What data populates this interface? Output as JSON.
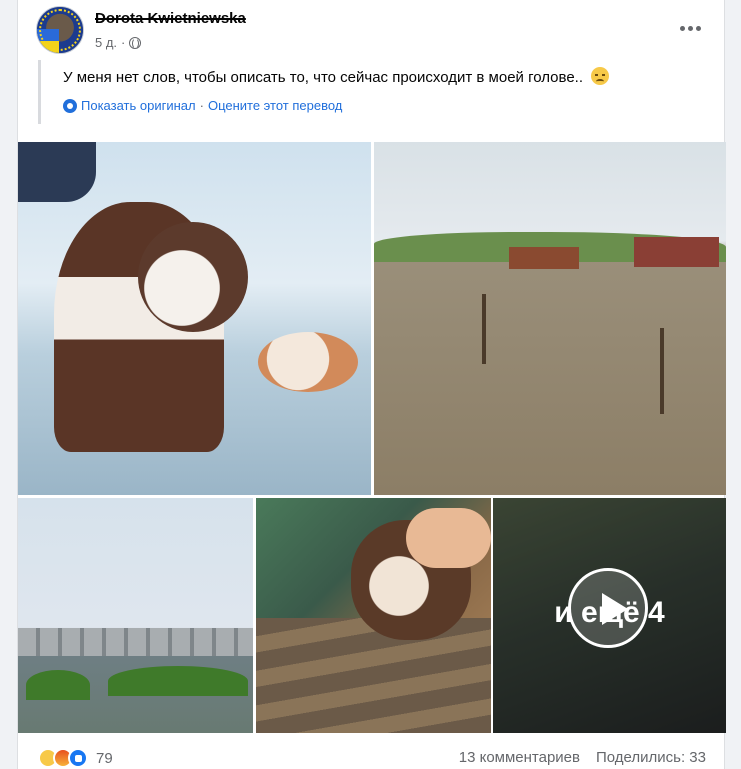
{
  "post": {
    "author": "Dorota Kwietniewska",
    "time": "5 д.",
    "text": "У меня нет слов, чтобы описать то, что сейчас происходит в моей голове..",
    "translation": {
      "show_original": "Показать оригинал",
      "separator": "·",
      "rate_translation": "Оцените этот перевод"
    }
  },
  "photos": {
    "more_label": "и ещё 4"
  },
  "footer": {
    "reaction_count": "79",
    "comments": "13 комментариев",
    "shares": "Поделились: 33"
  },
  "icons": {
    "more": "more-options-icon",
    "privacy": "globe-icon",
    "translate": "gear-icon",
    "play": "play-icon",
    "reactions": [
      "sad-reaction-icon",
      "angry-reaction-icon",
      "like-reaction-icon"
    ]
  },
  "colors": {
    "link": "#216fdb",
    "secondary_text": "#65676b",
    "like_blue": "#1877f2"
  }
}
